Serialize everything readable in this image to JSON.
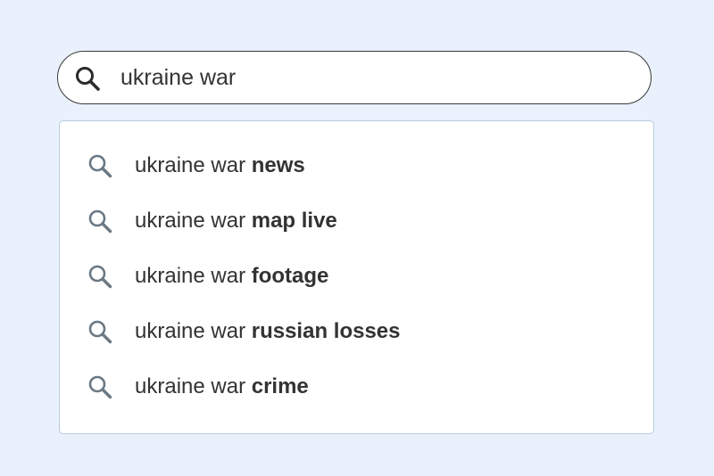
{
  "search": {
    "value": "ukraine war",
    "icon": "search-icon"
  },
  "suggestions": [
    {
      "query": "ukraine war",
      "completion": "news",
      "icon": "search-icon"
    },
    {
      "query": "ukraine war",
      "completion": "map live",
      "icon": "search-icon"
    },
    {
      "query": "ukraine war",
      "completion": "footage",
      "icon": "search-icon"
    },
    {
      "query": "ukraine war",
      "completion": "russian losses",
      "icon": "search-icon"
    },
    {
      "query": "ukraine war",
      "completion": "crime",
      "icon": "search-icon"
    }
  ],
  "colors": {
    "background": "#e9f1fc",
    "search_border": "#3a3a3a",
    "dropdown_border": "#b8ccde",
    "suggestion_icon": "#6b7884",
    "text": "#333333"
  }
}
